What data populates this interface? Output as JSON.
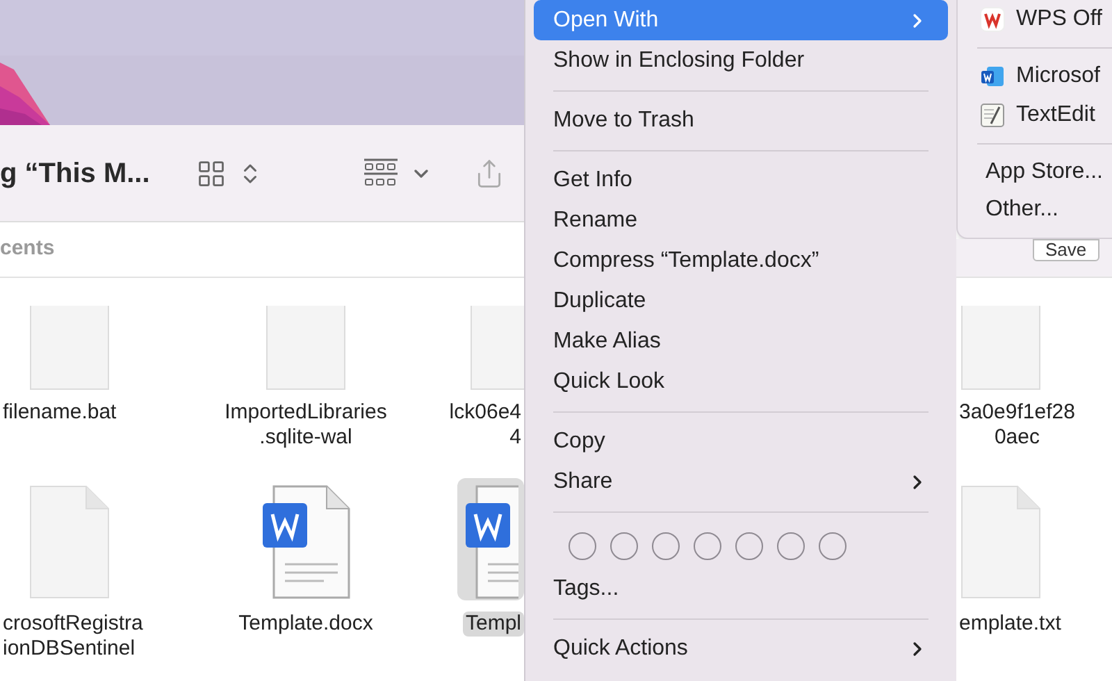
{
  "finder": {
    "title": "g “This M...",
    "section": "cents",
    "save_button": "Save"
  },
  "file_rows": [
    [
      {
        "kind": "blank",
        "lines": [
          "filename.bat"
        ],
        "selected": false
      },
      {
        "kind": "blank",
        "lines": [
          "ImportedLibraries",
          ".sqlite-wal"
        ],
        "selected": false
      },
      {
        "kind": "blank",
        "lines": [
          "lck06e4",
          "4"
        ],
        "selected": false
      },
      {
        "kind": "blank",
        "lines": [
          "3a0e9f1ef28",
          "0aec"
        ],
        "selected": false
      }
    ],
    [
      {
        "kind": "blank",
        "lines": [
          "crosoftRegistra",
          "ionDBSentinel"
        ],
        "selected": false
      },
      {
        "kind": "word",
        "lines": [
          "Template.docx"
        ],
        "selected": false
      },
      {
        "kind": "word",
        "lines": [
          "Templ"
        ],
        "selected": true
      },
      {
        "kind": "blank",
        "lines": [
          "emplate.txt"
        ],
        "selected": false
      }
    ]
  ],
  "context_menu": [
    {
      "kind": "item",
      "label": "Open With",
      "selected": true,
      "submenu": true
    },
    {
      "kind": "item",
      "label": "Show in Enclosing Folder",
      "selected": false,
      "submenu": false
    },
    {
      "kind": "separator"
    },
    {
      "kind": "item",
      "label": "Move to Trash",
      "selected": false,
      "submenu": false
    },
    {
      "kind": "separator"
    },
    {
      "kind": "item",
      "label": "Get Info",
      "selected": false,
      "submenu": false
    },
    {
      "kind": "item",
      "label": "Rename",
      "selected": false,
      "submenu": false
    },
    {
      "kind": "item",
      "label": "Compress “Template.docx”",
      "selected": false,
      "submenu": false
    },
    {
      "kind": "item",
      "label": "Duplicate",
      "selected": false,
      "submenu": false
    },
    {
      "kind": "item",
      "label": "Make Alias",
      "selected": false,
      "submenu": false
    },
    {
      "kind": "item",
      "label": "Quick Look",
      "selected": false,
      "submenu": false
    },
    {
      "kind": "separator"
    },
    {
      "kind": "item",
      "label": "Copy",
      "selected": false,
      "submenu": false
    },
    {
      "kind": "item",
      "label": "Share",
      "selected": false,
      "submenu": true
    },
    {
      "kind": "separator"
    },
    {
      "kind": "tags"
    },
    {
      "kind": "item",
      "label": "Tags...",
      "selected": false,
      "submenu": false
    },
    {
      "kind": "separator"
    },
    {
      "kind": "item",
      "label": "Quick Actions",
      "selected": false,
      "submenu": true
    }
  ],
  "open_with_menu": [
    {
      "kind": "app",
      "label": "WPS Off"
    },
    {
      "kind": "separator"
    },
    {
      "kind": "app",
      "label": "Microsof"
    },
    {
      "kind": "app",
      "label": "TextEdit"
    },
    {
      "kind": "separator"
    },
    {
      "kind": "item",
      "label": "App Store..."
    },
    {
      "kind": "item",
      "label": "Other..."
    }
  ]
}
